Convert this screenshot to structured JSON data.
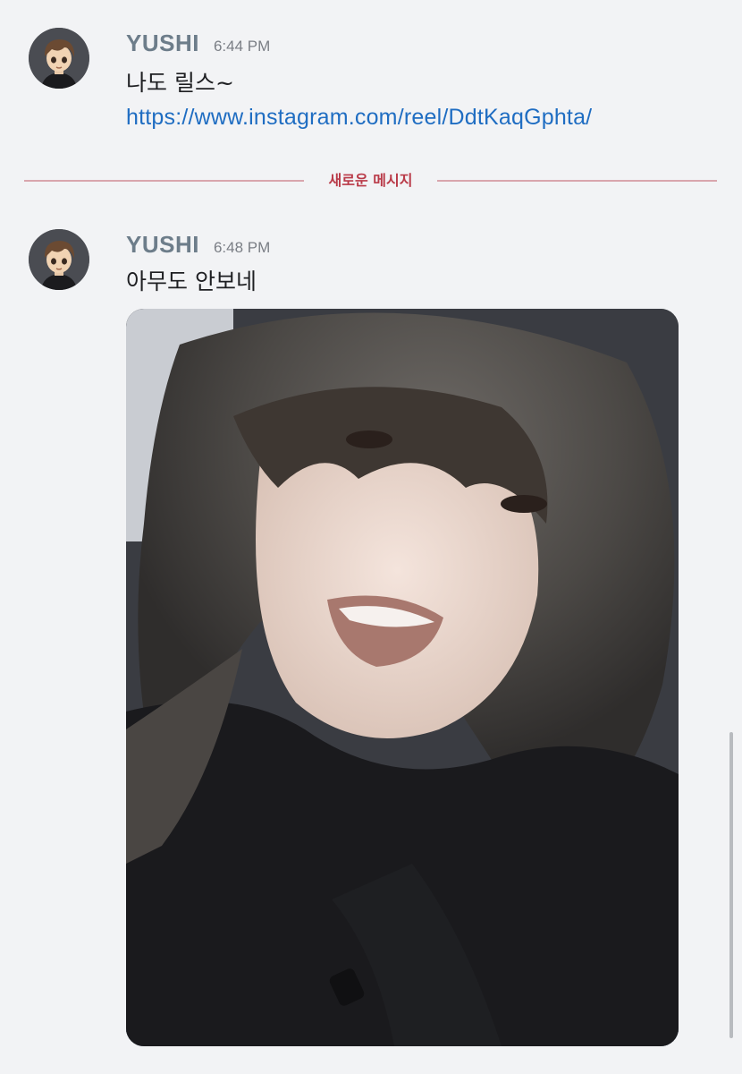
{
  "messages": [
    {
      "username": "YUSHI",
      "time": "6:44 PM",
      "text": "나도 릴스~",
      "link": "https://www.instagram.com/reel/DdtKaqGphta/"
    },
    {
      "username": "YUSHI",
      "time": "6:48 PM",
      "text": "아무도 안보네"
    }
  ],
  "divider": {
    "label": "새로운 메시지"
  },
  "colors": {
    "background": "#f2f3f5",
    "username": "#6d7d8a",
    "link": "#1f6dc2",
    "new_messages_divider": "#b93a48"
  },
  "icons": {
    "avatar": "cartoon-boy-avatar",
    "attachment": "selfie-photo-attachment"
  }
}
